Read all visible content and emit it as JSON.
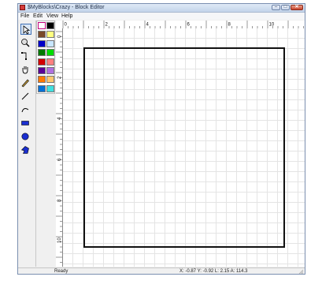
{
  "window": {
    "title": "$MyBlocks\\Crazy - Block Editor"
  },
  "title_buttons": {
    "minimize": "–",
    "maximize": "□",
    "close": "✕"
  },
  "menu": [
    "File",
    "Edit",
    "View",
    "Help"
  ],
  "tools": [
    {
      "name": "arrow-tool-icon",
      "glyph": "↖"
    },
    {
      "name": "zoom-tool-icon",
      "glyph": "⊕"
    },
    {
      "name": "reshape-tool-icon",
      "glyph": "⌐"
    },
    {
      "name": "hand-tool-icon",
      "glyph": "✋"
    },
    {
      "name": "freehand-tool-icon",
      "glyph": "✎"
    },
    {
      "name": "line-tool-icon",
      "glyph": "╱"
    },
    {
      "name": "curve-tool-icon",
      "glyph": "⌒"
    },
    {
      "name": "rectangle-tool-icon",
      "glyph": "▬"
    },
    {
      "name": "ellipse-tool-icon",
      "glyph": "●"
    },
    {
      "name": "polygon-tool-icon",
      "glyph": "⬟"
    }
  ],
  "palette": [
    [
      "#ffffff",
      "#000000"
    ],
    [
      "#7a4a2a",
      "#ffff80"
    ],
    [
      "#0000c8",
      "#c8e6ff"
    ],
    [
      "#007800",
      "#00dc00"
    ],
    [
      "#d20000",
      "#ff8080"
    ],
    [
      "#5a0096",
      "#b070e0"
    ],
    [
      "#ff7800",
      "#ffc870"
    ],
    [
      "#0070d8",
      "#40e0e0"
    ]
  ],
  "ruler": {
    "top_labels": [
      "0",
      "2",
      "4",
      "6",
      "8",
      "10"
    ],
    "left_labels": [
      "0",
      "2",
      "4",
      "6",
      "8",
      "10"
    ]
  },
  "status": {
    "ready": "Ready",
    "coords": "X:  -0.87 Y:  -0.92 L:  2.15 A:  114.3"
  }
}
